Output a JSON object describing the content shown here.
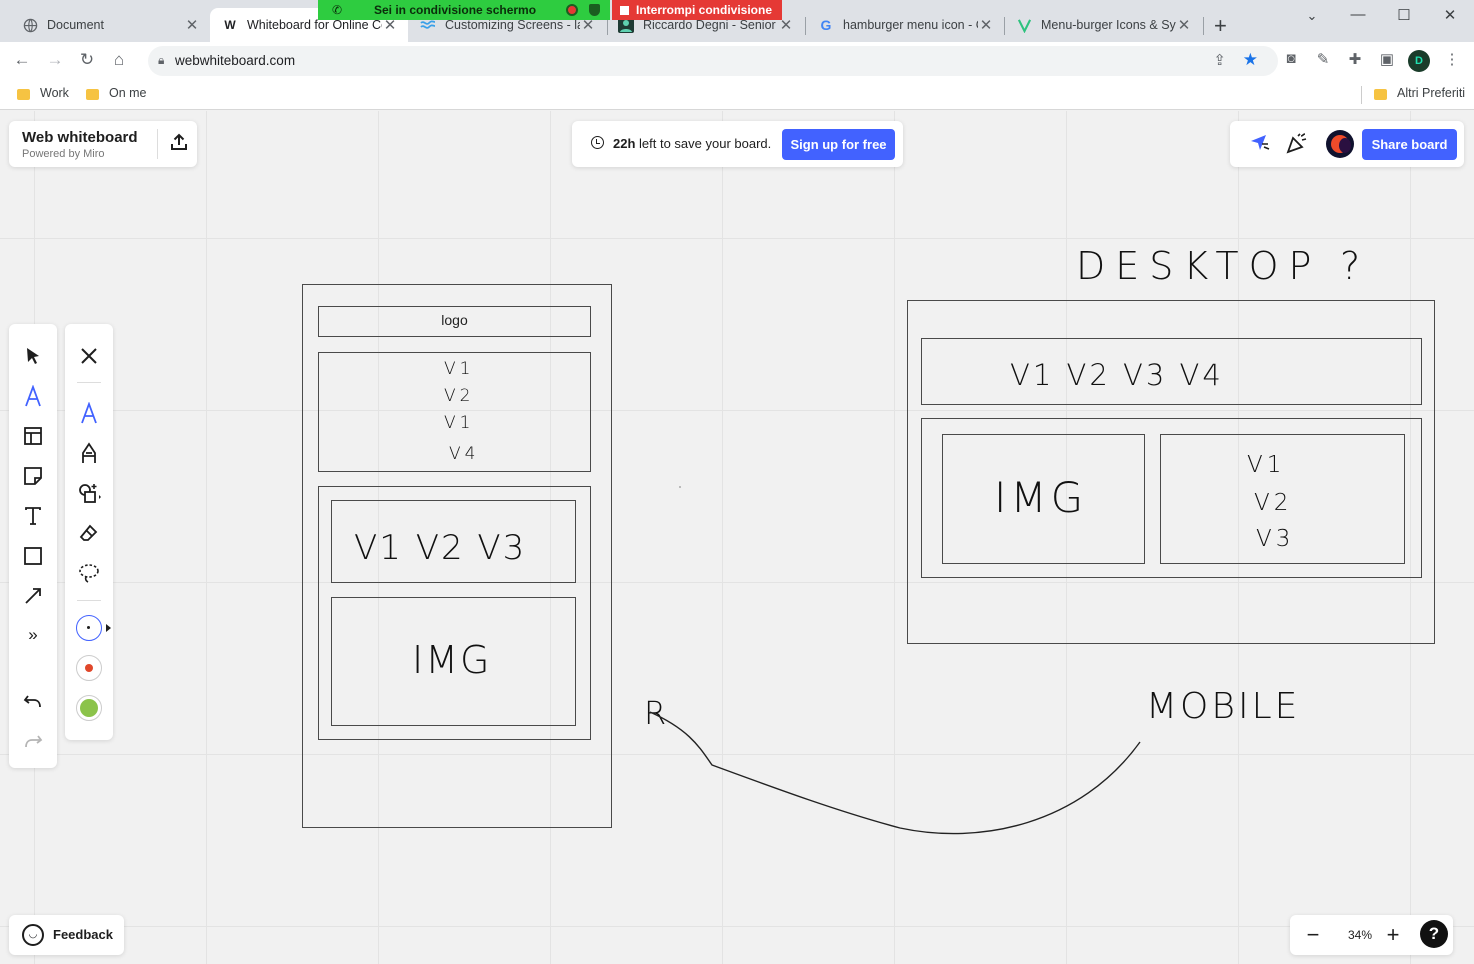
{
  "browser": {
    "tabs": [
      {
        "title": "Document",
        "favicon": "globe-icon",
        "active": false
      },
      {
        "title": "Whiteboard for Online Co",
        "favicon": "W",
        "active": true
      },
      {
        "title": "Customizing Screens - la",
        "favicon": "wave-icon",
        "active": false
      },
      {
        "title": "Riccardo Degni - Senior F",
        "favicon": "avatar-icon",
        "active": false
      },
      {
        "title": "hamburger menu icon - G",
        "favicon": "G",
        "active": false
      },
      {
        "title": "Menu-burger Icons & Syr",
        "favicon": "leaf-icon",
        "active": false
      }
    ],
    "screen_share": {
      "status_label": "Sei in condivisione schermo",
      "stop_label": "Interrompi condivisione"
    },
    "url": "webwhiteboard.com",
    "bookmarks": [
      "Work",
      "On me"
    ],
    "other_bookmarks": "Altri Preferiti",
    "profile_initial": "D"
  },
  "app": {
    "title": "Web whiteboard",
    "subtitle": "Powered by Miro",
    "save_hours": "22h",
    "save_message": " left to save your board.",
    "signup_label": "Sign up for free",
    "share_label": "Share board",
    "feedback_label": "Feedback",
    "zoom": "34%",
    "help_label": "?",
    "accent_color": "#4262ff"
  },
  "board": {
    "mobile_wireframe": {
      "logo_label": "logo",
      "menu_items": [
        "V1",
        "V2",
        "V1",
        "V4"
      ],
      "nav_items": "V1  V2  V3",
      "image_label": "IMG"
    },
    "desktop_wireframe": {
      "heading": "DESKTOP",
      "nav_items": "V1   V2   V3   V4",
      "image_label": "IMG",
      "side_menu": [
        "V1",
        "V2",
        "V3"
      ]
    },
    "mobile_label": "MOBILE",
    "arrow_label": "R"
  }
}
